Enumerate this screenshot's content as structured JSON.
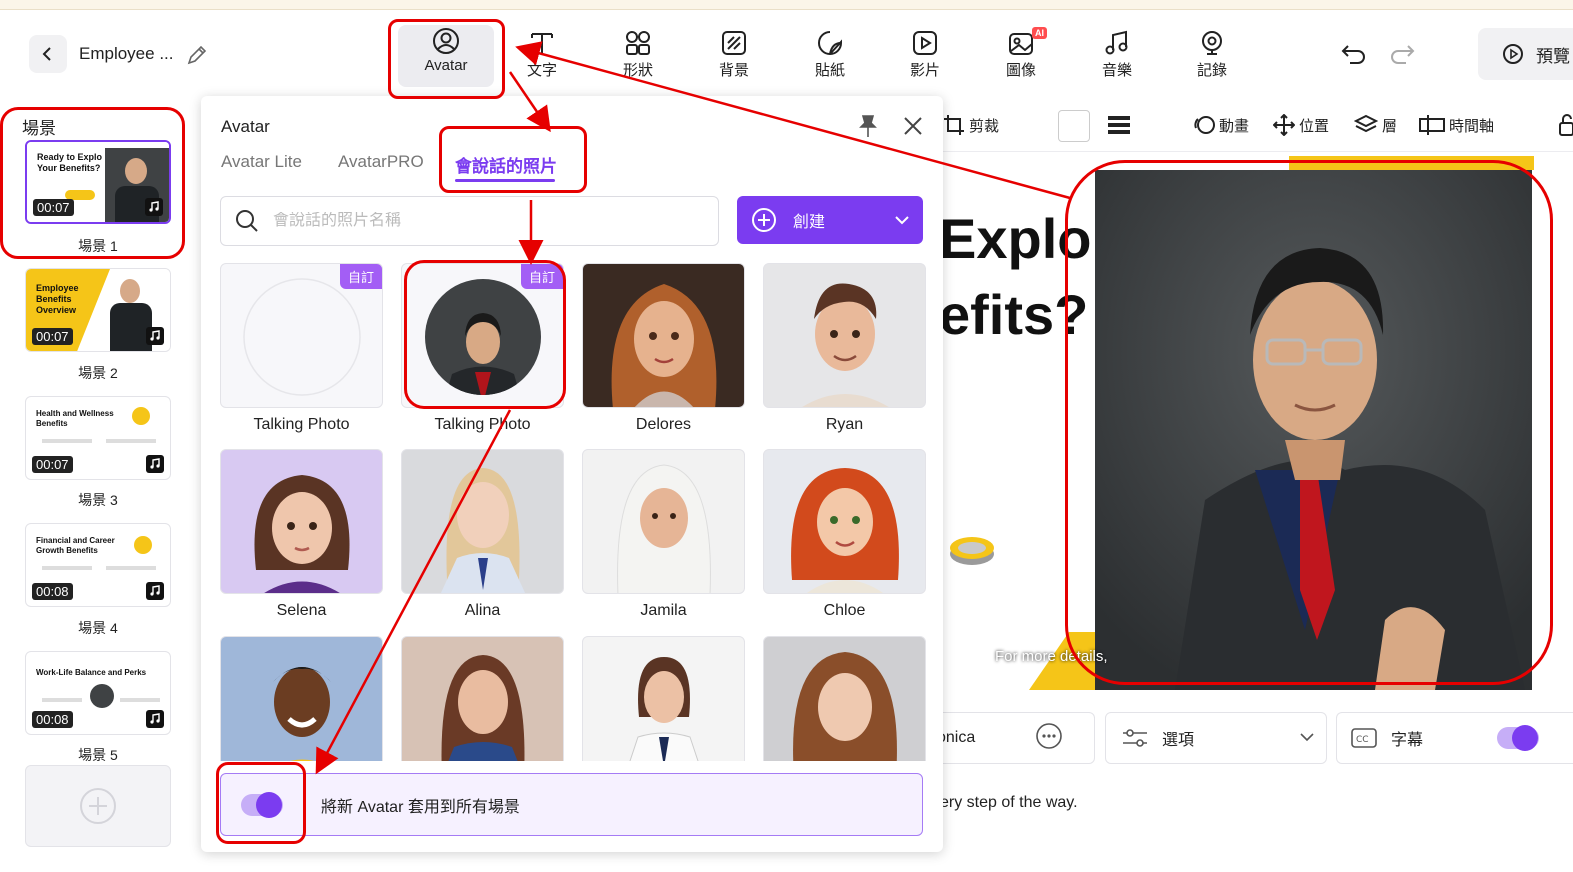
{
  "project": {
    "title": "Employee ..."
  },
  "toolbar": {
    "tools": [
      {
        "label": "Avatar",
        "icon": "avatar-icon"
      },
      {
        "label": "文字",
        "icon": "text-icon"
      },
      {
        "label": "形狀",
        "icon": "shapes-icon"
      },
      {
        "label": "背景",
        "icon": "background-icon"
      },
      {
        "label": "貼紙",
        "icon": "sticker-icon"
      },
      {
        "label": "影片",
        "icon": "video-icon"
      },
      {
        "label": "圖像",
        "icon": "image-icon",
        "badge": "AI"
      },
      {
        "label": "音樂",
        "icon": "music-icon"
      },
      {
        "label": "記錄",
        "icon": "record-icon"
      }
    ],
    "preview_label": "預覽"
  },
  "scenes": {
    "title": "場景",
    "items": [
      {
        "label": "場景 1",
        "duration": "00:07",
        "thumb_text": "Ready to Explo Your Benefits?"
      },
      {
        "label": "場景 2",
        "duration": "00:07",
        "thumb_text": "Employee Benefits Overview"
      },
      {
        "label": "場景 3",
        "duration": "00:07",
        "thumb_text": "Health and Wellness Benefits"
      },
      {
        "label": "場景 4",
        "duration": "00:08",
        "thumb_text": "Financial and Career Growth Benefits"
      },
      {
        "label": "場景 5",
        "duration": "00:08",
        "thumb_text": "Work-Life Balance and Perks"
      }
    ]
  },
  "panel": {
    "title": "Avatar",
    "tabs": [
      "Avatar Lite",
      "AvatarPRO",
      "會說話的照片"
    ],
    "search_placeholder": "會說話的照片名稱",
    "create_label": "創建",
    "custom_tag": "自訂",
    "avatars": [
      {
        "name": "Talking Photo",
        "custom": true,
        "style": "empty"
      },
      {
        "name": "Talking Photo",
        "custom": true,
        "style": "man-photo"
      },
      {
        "name": "Delores",
        "style": "f1"
      },
      {
        "name": "Ryan",
        "style": "m1"
      },
      {
        "name": "Selena",
        "style": "f2"
      },
      {
        "name": "Alina",
        "style": "f3"
      },
      {
        "name": "Jamila",
        "style": "f4"
      },
      {
        "name": "Chloe",
        "style": "f5"
      },
      {
        "name": "",
        "style": "m2"
      },
      {
        "name": "",
        "style": "f6"
      },
      {
        "name": "",
        "style": "f7"
      },
      {
        "name": "",
        "style": "f8"
      }
    ],
    "apply_all_label": "將新 Avatar 套用到所有場景",
    "apply_all_on": true
  },
  "editor": {
    "subtools": [
      "剪裁",
      "動畫",
      "位置",
      "層",
      "時間軸"
    ],
    "canvas_text_1": "Explo",
    "canvas_text_2": "efits?",
    "caption": "For more details,",
    "voice_name": "onica",
    "options_label": "選項",
    "subtitle_label": "字幕",
    "script_text": "ery step of the way."
  },
  "colors": {
    "accent": "#7b3cf0",
    "highlight": "#e60000",
    "yellow": "#ffc107"
  }
}
